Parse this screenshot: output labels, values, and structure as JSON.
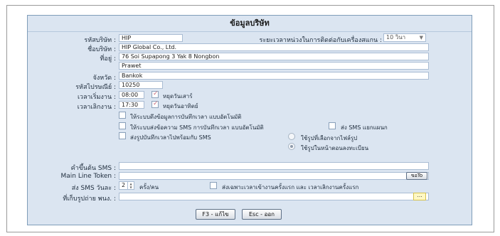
{
  "form": {
    "title": "ข้อมูลบริษัท",
    "company_code": {
      "label": "รหัสบริษัท :",
      "value": "HIP"
    },
    "scanner_interval": {
      "label": "ระยะเวลาหน่วงในการติดต่อกับเครื่องสแกน :",
      "value": "10 วินา"
    },
    "company_name": {
      "label": "ชื่อบริษัท :",
      "value": "HIP Global Co., Ltd."
    },
    "address": {
      "label": "ที่อยู่ :",
      "line1": "76 Soi Supapong 3 Yak 8 Nongbon",
      "line2": "Prawet"
    },
    "province": {
      "label": "จังหวัด :",
      "value": "Bankok"
    },
    "postcode": {
      "label": "รหัสไปรษณีย์ :",
      "value": "10250"
    },
    "work_start": {
      "label": "เวลาเริ่มงาน :",
      "value": "08:00",
      "check_label": "หยุดวันเสาร์",
      "checked": true
    },
    "work_end": {
      "label": "เวลาเลิกงาน :",
      "value": "17:30",
      "check_label": "หยุดวันอาทิตย์",
      "checked": true
    },
    "opt_auto_record": "ให้ระบบดึงข้อมูลการบันทึกเวลา แบบอัตโนมัติ",
    "opt_sms_auto": "ให้ระบบส่งข้อความ SMS การบันทึกเวลา แบบอัตโนมัติ",
    "opt_sms_split": "ส่ง SMS แยกแผนก",
    "opt_send_photo": "ส่งรูปบันทึกเวลาไปพร้อมกับ SMS",
    "radio_from_file": "ใช้รูปที่เลือกจากไฟล์รูป",
    "radio_from_register": "ใช้รูปในหน้าตอนลงทะเบียน",
    "sms_prefix": {
      "label": "คำขึ้นต้น SMS :",
      "value": ""
    },
    "line_token": {
      "label": "Main Line Token :",
      "value": "",
      "button": "ขอTo"
    },
    "sms_per_day": {
      "label": "ส่ง SMS วันละ :",
      "value": "2",
      "unit": "ครั้ง/คน",
      "check_label": "ส่งเฉพาะเวลาเข้างานครั้งแรก และ เวลาเลิกงานครั้งแรก"
    },
    "photo_folder": {
      "label": "ที่เก็บรูปถ่าย พนง. :",
      "value": "",
      "button": "..."
    },
    "buttons": {
      "edit": "F3 - แก้ไข",
      "exit": "Esc - ออก"
    }
  }
}
